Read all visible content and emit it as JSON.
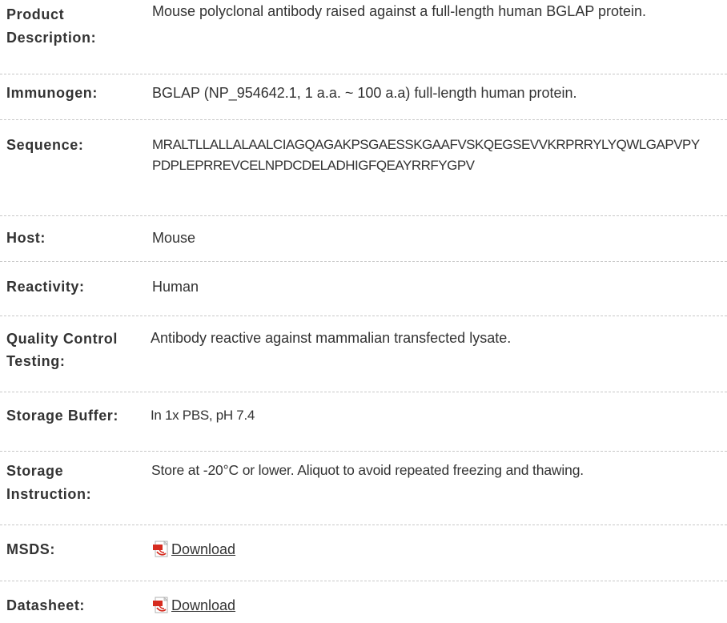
{
  "rows": [
    {
      "key": "product_description",
      "label": "Product Description:",
      "value": "Mouse polyclonal antibody raised against a full-length human BGLAP protein."
    },
    {
      "key": "immunogen",
      "label": "Immunogen:",
      "value": "BGLAP (NP_954642.1, 1 a.a. ~ 100 a.a) full-length human protein."
    },
    {
      "key": "sequence",
      "label": "Sequence:",
      "value": "MRALTLLALLALAALCIAGQAGAKPSGAESSKGAAFVSKQEGSEVVKRPRRYLYQWLGAPVPYPDPLEPRREVCELNPDCDELADHIGFQEAYRRFYGPV"
    },
    {
      "key": "host",
      "label": "Host:",
      "value": "Mouse"
    },
    {
      "key": "reactivity",
      "label": "Reactivity:",
      "value": "Human"
    },
    {
      "key": "qc_testing",
      "label": "Quality Control Testing:",
      "value": "Antibody reactive against mammalian transfected lysate."
    },
    {
      "key": "storage_buffer",
      "label": "Storage Buffer:",
      "value": "In 1x PBS, pH 7.4"
    },
    {
      "key": "storage_instruction",
      "label": "Storage Instruction:",
      "value": "Store at -20°C or lower. Aliquot to avoid repeated freezing and thawing."
    },
    {
      "key": "msds",
      "label": "MSDS:",
      "link_text": "Download",
      "icon": "pdf-icon"
    },
    {
      "key": "datasheet",
      "label": "Datasheet:",
      "link_text": "Download",
      "icon": "pdf-icon"
    }
  ],
  "colors": {
    "text": "#333333",
    "divider": "#c8c8c8",
    "pdf_red": "#d62b1f"
  }
}
